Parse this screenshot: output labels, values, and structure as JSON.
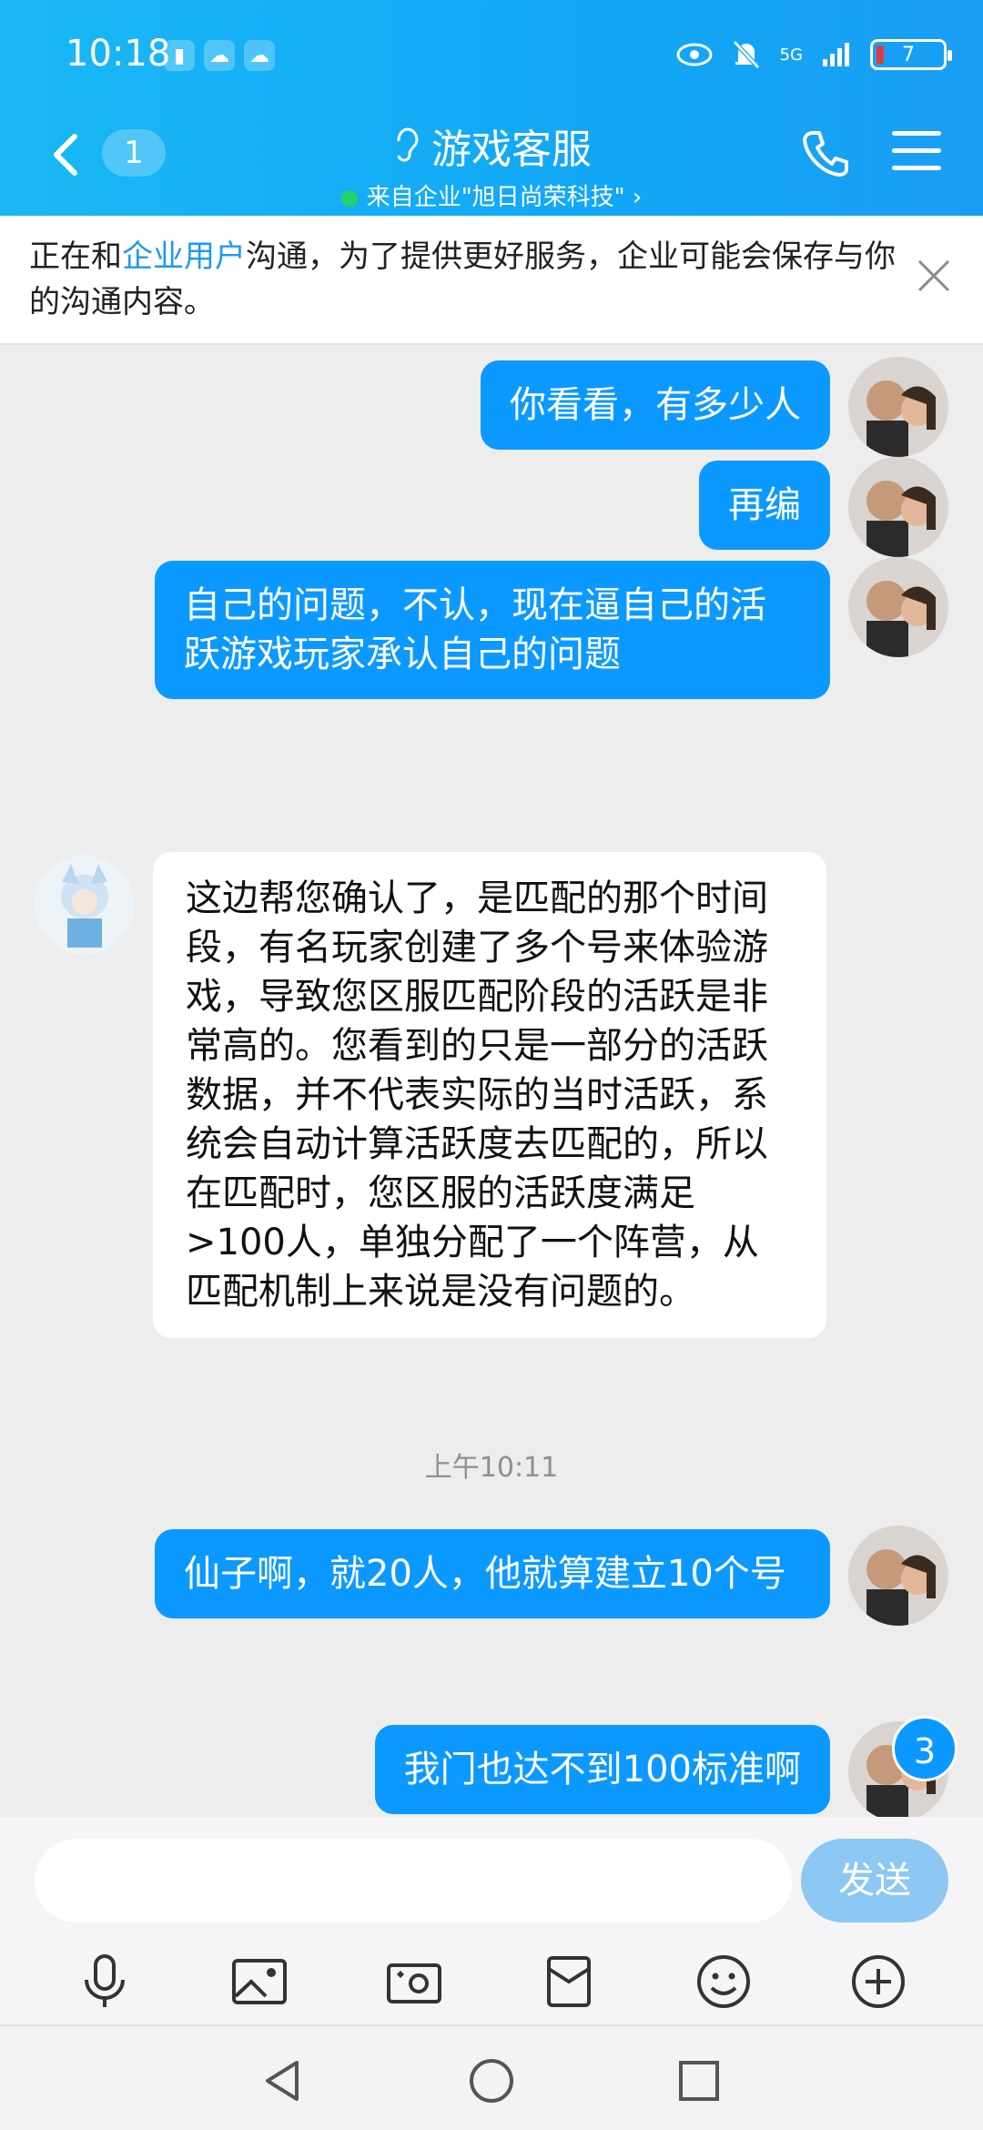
{
  "status_bar": {
    "time": "10:18",
    "network": "5G",
    "battery": "7"
  },
  "header": {
    "back_badge": "1",
    "title": "游戏客服",
    "subtitle": "来自企业\"旭日尚荣科技\" ›"
  },
  "notice": {
    "text_before": "正在和",
    "link": "企业用户",
    "text_after": "沟通，为了提供更好服务，企业可能会保存与你的沟通内容。",
    "close_icon": "close-icon"
  },
  "messages": [
    {
      "side": "out",
      "text": "你看看，有多少人"
    },
    {
      "side": "out",
      "text": "再编"
    },
    {
      "side": "out",
      "text": "自己的问题，不认，现在逼自己的活跃游戏玩家承认自己的问题"
    },
    {
      "side": "in",
      "text": "这边帮您确认了，是匹配的那个时间段，有名玩家创建了多个号来体验游戏，导致您区服匹配阶段的活跃是非常高的。您看到的只是一部分的活跃数据，并不代表实际的当时活跃，系统会自动计算活跃度去匹配的，所以在匹配时，您区服的活跃度满足>100人，单独分配了一个阵营，从匹配机制上来说是没有问题的。"
    },
    {
      "side": "out",
      "text": "仙子啊，就20人，他就算建立10个号"
    },
    {
      "side": "out",
      "text": "我门也达不到100标准啊"
    }
  ],
  "timestamp": "上午10:11",
  "unread_count": "3",
  "composer": {
    "placeholder": "",
    "send_label": "发送"
  },
  "colors": {
    "header": "#11a7f6",
    "bubble_out": "#0c99ff",
    "send_disabled": "#8cc8f3"
  }
}
